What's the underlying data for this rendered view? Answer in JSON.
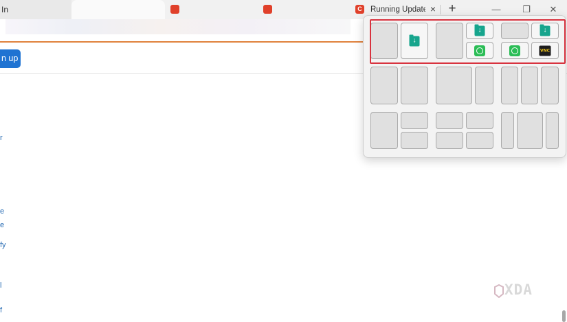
{
  "browser": {
    "first_tab_fragment": "In",
    "current_tab": {
      "title": "Running Updates",
      "favicon_letter": "C"
    },
    "new_tab_symbol": "+",
    "tab_close_symbol": "×",
    "window_controls": {
      "minimize": "—",
      "maximize": "❐",
      "close": "✕"
    }
  },
  "page": {
    "signup_button": "n up",
    "link_fragments": [
      "r",
      "e",
      "e",
      "fy",
      "l",
      "f"
    ]
  },
  "snap_layouts": {
    "highlight_color": "#d8333f",
    "apps": {
      "folder": "folder-download-icon",
      "whatsapp": "whatsapp-icon",
      "vnc": "vnc-viewer-icon",
      "vnc_label": "VNC"
    }
  },
  "watermark": {
    "text": "XDA"
  }
}
